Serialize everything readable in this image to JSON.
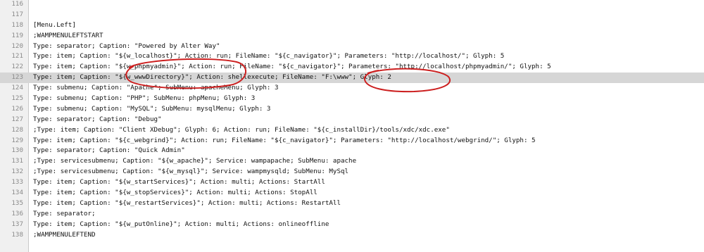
{
  "editor": {
    "lines": [
      {
        "number": "116",
        "text": ""
      },
      {
        "number": "117",
        "text": ""
      },
      {
        "number": "118",
        "text": "[Menu.Left]"
      },
      {
        "number": "119",
        "text": ";WAMPMENULEFTSTART"
      },
      {
        "number": "120",
        "text": "Type: separator; Caption: \"Powered by Alter Way\""
      },
      {
        "number": "121",
        "text": "Type: item; Caption: \"${w_localhost}\"; Action: run; FileName: \"${c_navigator}\"; Parameters: \"http://localhost/\"; Glyph: 5"
      },
      {
        "number": "122",
        "text": "Type: item; Caption: \"${w_phpmyadmin}\"; Action: run; FileName: \"${c_navigator}\"; Parameters: \"http://localhost/phpmyadmin/\"; Glyph: 5"
      },
      {
        "number": "123",
        "text": "Type: item; Caption: \"${w_wwwDirectory}\"; Action: shellexecute; FileName: \"F:\\www\"; Glyph: 2"
      },
      {
        "number": "124",
        "text": "Type: submenu; Caption: \"Apache\"; SubMenu: apacheMenu; Glyph: 3"
      },
      {
        "number": "125",
        "text": "Type: submenu; Caption: \"PHP\"; SubMenu: phpMenu; Glyph: 3"
      },
      {
        "number": "126",
        "text": "Type: submenu; Caption: \"MySQL\"; SubMenu: mysqlMenu; Glyph: 3"
      },
      {
        "number": "127",
        "text": "Type: separator; Caption: \"Debug\""
      },
      {
        "number": "128",
        "text": ";Type: item; Caption: \"Client XDebug\"; Glyph: 6; Action: run; FileName: \"${c_installDir}/tools/xdc/xdc.exe\""
      },
      {
        "number": "129",
        "text": "Type: item; Caption: \"${c_webgrind}\"; Action: run; FileName: \"${c_navigator}\"; Parameters: \"http://localhost/webgrind/\"; Glyph: 5"
      },
      {
        "number": "130",
        "text": "Type: separator; Caption: \"Quick Admin\""
      },
      {
        "number": "131",
        "text": ";Type: servicesubmenu; Caption: \"${w_apache}\"; Service: wampapache; SubMenu: apache"
      },
      {
        "number": "132",
        "text": ";Type: servicesubmenu; Caption: \"${w_mysql}\"; Service: wampmysqld; SubMenu: MySql"
      },
      {
        "number": "133",
        "text": "Type: item; Caption: \"${w_startServices}\"; Action: multi; Actions: StartAll"
      },
      {
        "number": "134",
        "text": "Type: item; Caption: \"${w_stopServices}\"; Action: multi; Actions: StopAll"
      },
      {
        "number": "135",
        "text": "Type: item; Caption: \"${w_restartServices}\"; Action: multi; Actions: RestartAll"
      },
      {
        "number": "136",
        "text": "Type: separator;"
      },
      {
        "number": "137",
        "text": "Type: item; Caption: \"${w_putOnline}\"; Action: multi; Actions: onlineoffline"
      },
      {
        "number": "138",
        "text": ";WAMPMENULEFTEND"
      }
    ]
  },
  "colors": {
    "highlight": "#d6d6d6",
    "annotation": "#cc1f1f",
    "gutter": "#f0f0f0",
    "line_number": "#8a8a8a"
  }
}
